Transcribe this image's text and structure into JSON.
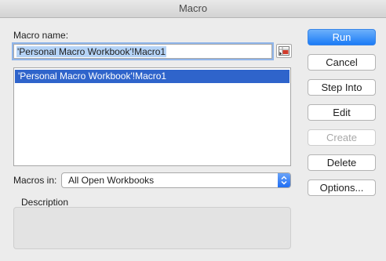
{
  "window": {
    "title": "Macro"
  },
  "macro_name": {
    "label": "Macro name:",
    "value": "'Personal Macro Workbook'!Macro1"
  },
  "macro_list": {
    "items": [
      {
        "label": "'Personal Macro Workbook'!Macro1",
        "selected": true
      }
    ]
  },
  "macros_in": {
    "label": "Macros in:",
    "selected": "All Open Workbooks"
  },
  "description": {
    "label": "Description",
    "text": ""
  },
  "buttons": {
    "run": "Run",
    "cancel": "Cancel",
    "step_into": "Step Into",
    "edit": "Edit",
    "create": "Create",
    "delete": "Delete",
    "options": "Options..."
  },
  "colors": {
    "accent": "#1b7bf6",
    "selection": "#2f64cb",
    "window_bg": "#ececec"
  },
  "icons": {
    "collapse": "range-collapse-icon",
    "dropdown": "updown-chevron-icon"
  }
}
